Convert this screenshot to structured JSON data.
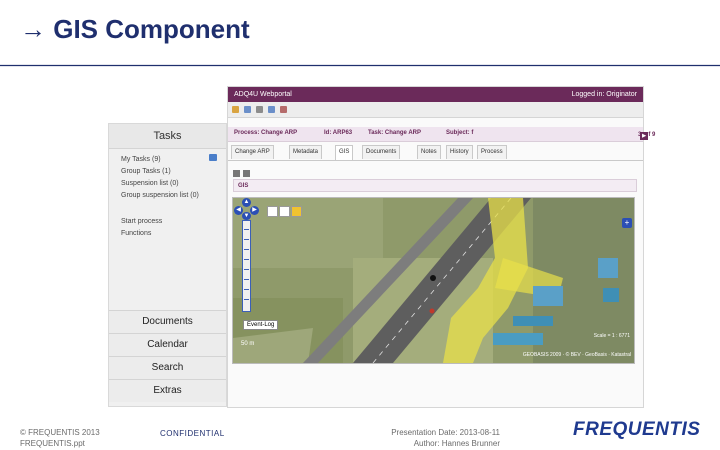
{
  "slide": {
    "title": "→ GIS Component",
    "accent_color": "#1f2f6e"
  },
  "tasks_panel": {
    "header": "Tasks",
    "items": [
      "My Tasks (9)",
      "Group Tasks (1)",
      "Suspension list (0)",
      "Group suspension list (0)",
      "Start process",
      "Functions"
    ],
    "nav": [
      "Documents",
      "Calendar",
      "Search",
      "Extras"
    ]
  },
  "app": {
    "title": "ADQ4U Webportal",
    "logged_in": "Logged in: Originator",
    "title_color": "#6b2a5a",
    "process": {
      "process": "Process: Change ARP",
      "id": "Id: ARP63",
      "task": "Task: Change ARP",
      "subject": "Subject: f",
      "paging": "3. of 9"
    },
    "tabs": [
      "Change ARP",
      "Metadata",
      "GIS",
      "Documents",
      "Notes",
      "History",
      "Process"
    ],
    "active_tab": "GIS",
    "section_label": "GIS",
    "map": {
      "event_log": "Event-Log",
      "scale_label": "Scale = 1 : 6771",
      "copyright": "GEOBASIS 2009 · © BEV · GeoBasis · Katastral",
      "highlight_color": "#e8e04a",
      "left_scale": "50 m"
    }
  },
  "footer": {
    "copyright_line1": "© FREQUENTIS 2013",
    "copyright_line2": "FREQUENTIS.ppt",
    "confidential": "CONFIDENTIAL",
    "presentation_date": "Presentation Date: 2013-08-11",
    "author": "Author: Hannes Brunner",
    "logo": "FREQUENTIS"
  }
}
